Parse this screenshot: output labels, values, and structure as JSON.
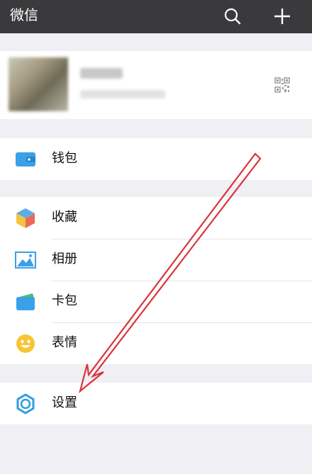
{
  "header": {
    "title": "微信"
  },
  "profile": {
    "name": "",
    "wechat_id": ""
  },
  "menu": {
    "wallet": "钱包",
    "favorites": "收藏",
    "album": "相册",
    "cards": "卡包",
    "stickers": "表情",
    "settings": "设置"
  },
  "colors": {
    "topbar": "#3a3a3c",
    "wallet_blue": "#3aa0e8",
    "settings_blue": "#2f9de0",
    "sticker_yellow": "#f7c531",
    "annotation_red": "#d9343a"
  }
}
